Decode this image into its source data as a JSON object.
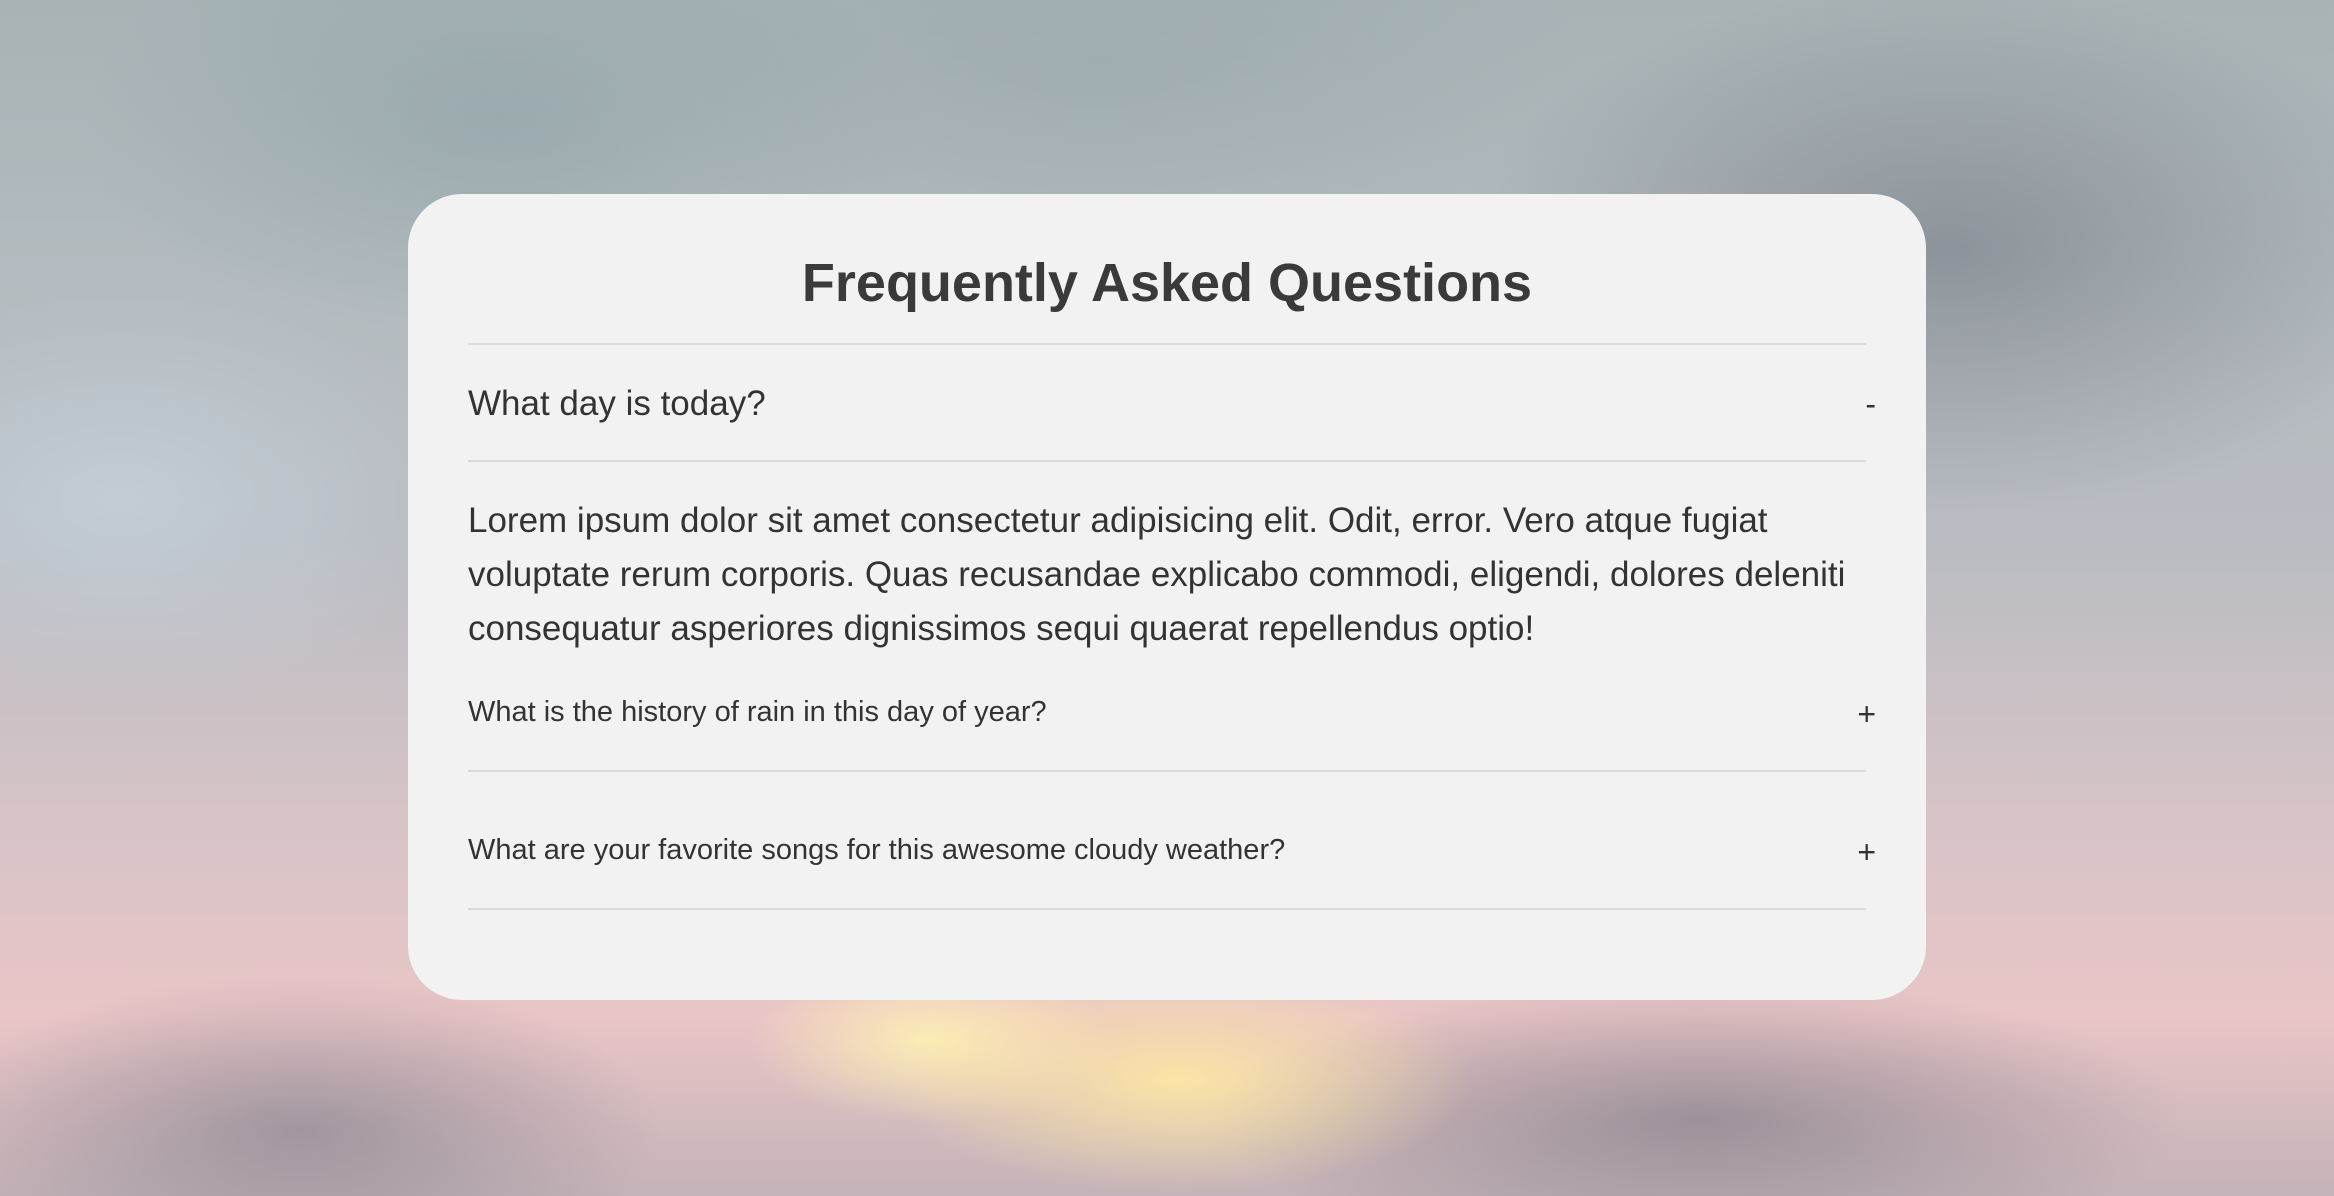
{
  "faq": {
    "title": "Frequently Asked Questions",
    "items": [
      {
        "question": "What day is today?",
        "toggle": "-",
        "answer": "Lorem ipsum dolor sit amet consectetur adipisicing elit. Odit, error. Vero atque fugiat voluptate rerum corporis. Quas recusandae explicabo commodi, eligendi, dolores deleniti consequatur asperiores dignissimos sequi quaerat repellendus optio!",
        "expanded": true
      },
      {
        "question": "What is the history of rain in this day of year?",
        "toggle": "+",
        "expanded": false
      },
      {
        "question": "What are your favorite songs for this awesome cloudy weather?",
        "toggle": "+",
        "expanded": false
      }
    ]
  },
  "colors": {
    "card_background": "#f2f2f2",
    "text": "#333333",
    "title": "#3a3a3a",
    "divider": "#d9d9d9"
  }
}
